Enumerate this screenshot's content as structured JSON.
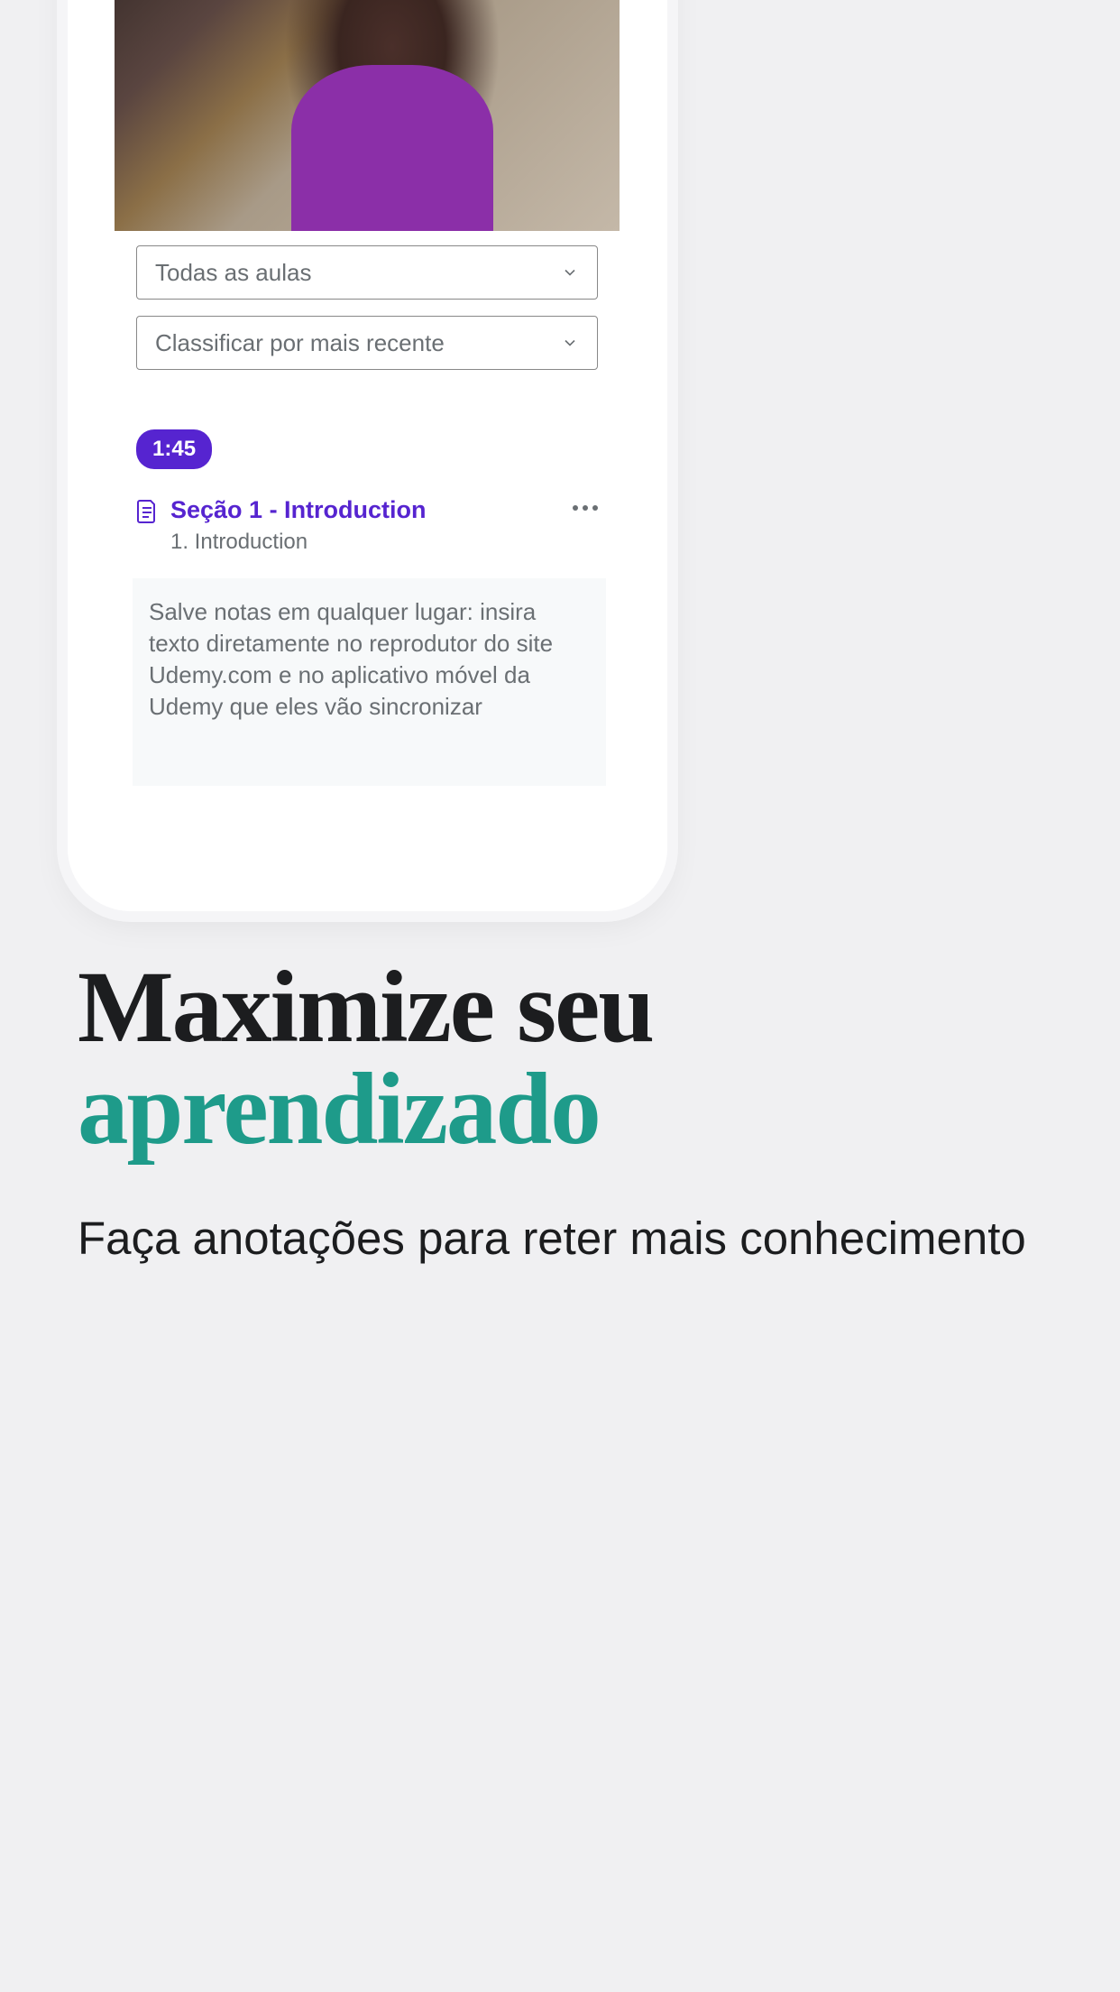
{
  "phone": {
    "dropdowns": {
      "filter_lessons": "Todas as aulas",
      "sort": "Classificar por mais recente"
    },
    "note": {
      "timestamp": "1:45",
      "section_title": "Seção 1 - Introduction",
      "lecture_title": "1. Introduction",
      "body": "Salve notas em qualquer lugar: insira texto diretamente no reprodutor do site Udemy.com e no aplicativo móvel da Udemy que eles vão sincronizar"
    }
  },
  "marketing": {
    "headline_line1": "Maximize seu",
    "headline_line2": "aprendizado",
    "subhead": "Faça anotações para reter mais conhecimento"
  },
  "colors": {
    "accent": "#5624d0",
    "teal": "#1e9b8a",
    "text_dark": "#1c1d1f",
    "text_muted": "#6a6f73"
  }
}
